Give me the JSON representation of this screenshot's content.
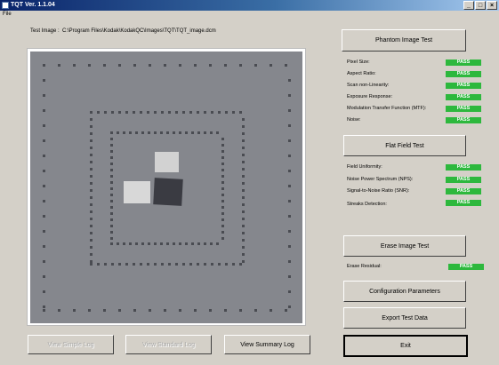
{
  "window": {
    "title": "TQT Ver. 1.1.04",
    "controls": [
      "_",
      "□",
      "×"
    ]
  },
  "menu": {
    "file": "File"
  },
  "test_image": {
    "label": "Test Image :",
    "path": "C:\\Program Files\\Kodak\\KodakQC\\Images\\TQT\\TQT_image.dcm"
  },
  "phantom_image_test": {
    "button": "Phantom Image Test",
    "results": [
      {
        "label": "Pixel Size:",
        "status": "PASS"
      },
      {
        "label": "Aspect Ratio:",
        "status": "PASS"
      },
      {
        "label": "Scan non-Linearity:",
        "status": "PASS"
      },
      {
        "label": "Exposure Response:",
        "status": "PASS"
      },
      {
        "label": "Modulation Transfer Function (MTF):",
        "status": "PASS"
      },
      {
        "label": "Noise:",
        "status": "PASS"
      }
    ]
  },
  "flat_field_test": {
    "button": "Flat Field Test",
    "results": [
      {
        "label": "Field Uniformity:",
        "status": "PASS"
      },
      {
        "label": "Noise Power Spectrum (NPS):",
        "status": "PASS"
      },
      {
        "label": "Signal-to-Noise Ratio (SNR):",
        "status": "PASS"
      },
      {
        "label": "Streaks Detection:",
        "status": "PASS"
      }
    ]
  },
  "erase_image_test": {
    "button": "Erase Image Test",
    "results": [
      {
        "label": "Erase Residual:",
        "status": "PASS"
      }
    ]
  },
  "buttons": {
    "configuration": "Configuration Parameters",
    "export": "Export Test Data",
    "exit": "Exit",
    "view_simple_log": "View Simple Log",
    "view_standard_log": "View Standard Log",
    "view_summary_log": "View Summary Log"
  },
  "colors": {
    "pass": "#2db83d",
    "phantom_bg": "#85878d",
    "marker": "#4a4c52"
  }
}
